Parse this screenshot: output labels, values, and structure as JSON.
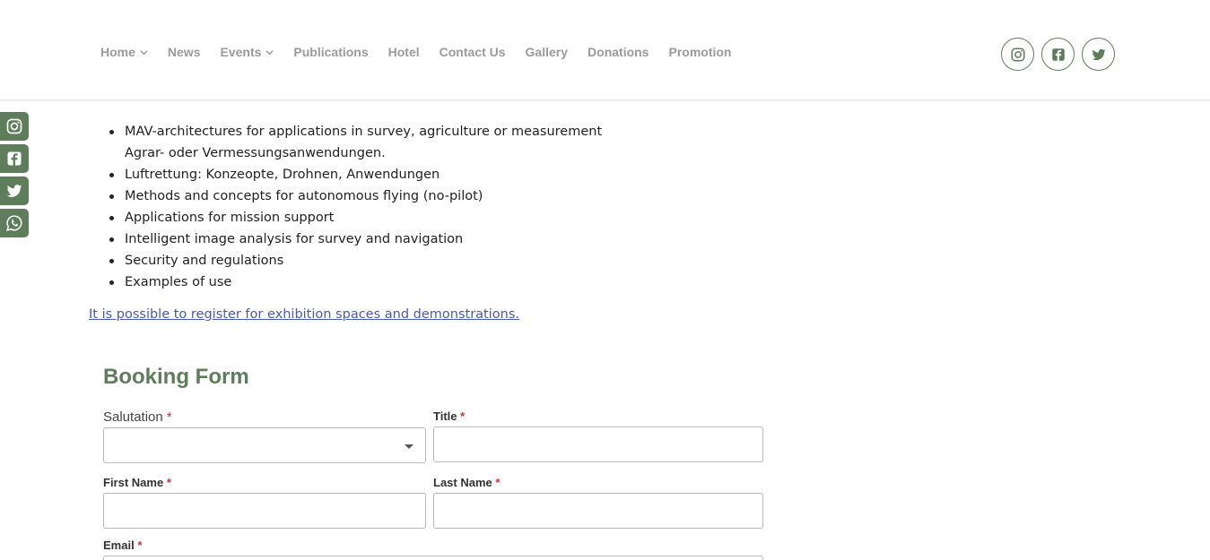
{
  "nav": {
    "items": [
      {
        "label": "Home",
        "has_dropdown": true
      },
      {
        "label": "News",
        "has_dropdown": false
      },
      {
        "label": "Events",
        "has_dropdown": true
      },
      {
        "label": "Publications",
        "has_dropdown": false
      },
      {
        "label": "Hotel",
        "has_dropdown": false
      },
      {
        "label": "Contact Us",
        "has_dropdown": false
      },
      {
        "label": "Gallery",
        "has_dropdown": false
      },
      {
        "label": "Donations",
        "has_dropdown": false
      },
      {
        "label": "Promotion",
        "has_dropdown": false
      }
    ]
  },
  "social_top": [
    "instagram-icon",
    "facebook-icon",
    "twitter-icon"
  ],
  "social_side": [
    "instagram-icon",
    "facebook-icon",
    "twitter-icon",
    "whatsapp-icon"
  ],
  "colors": {
    "accent": "#5e7e5b",
    "link": "#4a59b8",
    "required": "#d0312d",
    "nav_text": "#9b9b9b"
  },
  "content": {
    "bullets": [
      {
        "text": "MAV-architectures for applications in survey, agriculture or measurement",
        "sub": "Agrar- oder Vermessungsanwendungen."
      },
      {
        "text": "Luftrettung: Konzeopte, Drohnen, Anwendungen"
      },
      {
        "text": "Methods and concepts for autonomous flying (no-pilot)"
      },
      {
        "text": "Applications for mission support"
      },
      {
        "text": "Intelligent image analysis for survey and navigation"
      },
      {
        "text": "Security and regulations"
      },
      {
        "text": "Examples of use"
      }
    ],
    "register_link": "It is possible to register for exhibition spaces and demonstrations."
  },
  "form": {
    "title": "Booking Form",
    "salutation": {
      "label": "Salutation",
      "required_mark": "*",
      "value": ""
    },
    "title_field": {
      "label": "Title",
      "required_mark": "*",
      "value": ""
    },
    "first_name": {
      "label": "First Name",
      "required_mark": "*",
      "value": ""
    },
    "last_name": {
      "label": "Last Name",
      "required_mark": "*",
      "value": ""
    },
    "email": {
      "label": "Email",
      "required_mark": "*",
      "value": ""
    }
  }
}
